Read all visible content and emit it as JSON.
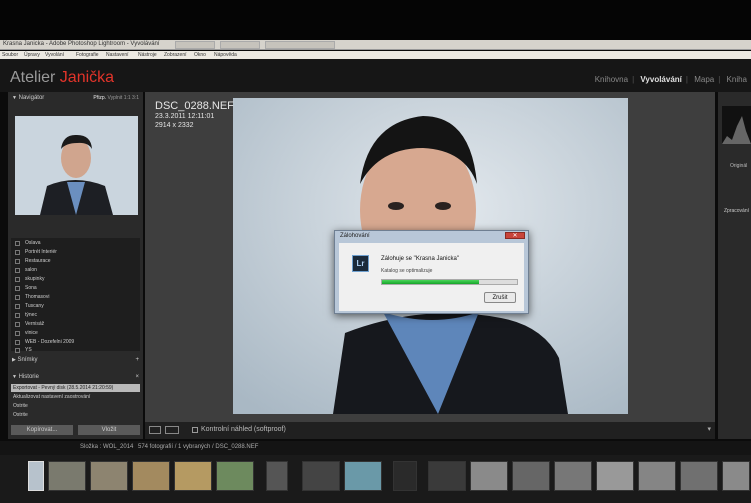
{
  "window": {
    "title": "Krasna Janicka - Adobe Photoshop Lightroom - Vyvolávání"
  },
  "menu": [
    "Soubor",
    "Úpravy",
    "Vyvolání",
    "Fotografie",
    "Nastavení",
    "Nástroje",
    "Zobrazení",
    "Okno",
    "Nápověda"
  ],
  "brand": {
    "main": "Atelier ",
    "accent": "Janička",
    "accent_color": "#e2342a"
  },
  "modules": [
    "Knihovna",
    "Vyvolávání",
    "Mapa",
    "Kniha"
  ],
  "left": {
    "navigator_label": "Navigátor",
    "nav_options": [
      "Přizp.",
      "Vyplnit",
      "1:1",
      "3:1"
    ],
    "collections": [
      "Oslava",
      "Portrét Interiér",
      "Restaurace",
      "salon",
      "skupinky",
      "Sona",
      "Thomasovi",
      "Tuscany",
      "týnec",
      "Vernisáž",
      "vinice",
      "WEB - Dozefelni 2009",
      "YS"
    ],
    "snapshots_label": "Snímky",
    "history_label": "Historie",
    "history": [
      "Exportovat - Pevný disk (28.5.2014 21:20:59)",
      "Aktualizovat nastavení zaostrování",
      "Ostrite",
      "Ostrite"
    ],
    "copy_btn": "Kopírovat...",
    "paste_btn": "Vložit"
  },
  "photo_info": {
    "filename": "DSC_0288.NEF",
    "date": "23.3.2011 12:11:01",
    "dims": "2914 x 2332"
  },
  "toolbar": {
    "softproof": "Kontrolní náhled (softproof)"
  },
  "right": {
    "original": "Originál",
    "processing": "Zpracování"
  },
  "filmstrip": {
    "folder": "Složka : WOL_2014",
    "count": "574 fotografií / 1 vybraných / DSC_0288.NEF"
  },
  "dialog": {
    "title": "Zálohování",
    "message": "Zálohuje se \"Krasna Janicka\"",
    "status": "Katalog se optimalizuje",
    "progress": 0.72,
    "cancel": "Zrušit",
    "lr_label": "Lr"
  }
}
